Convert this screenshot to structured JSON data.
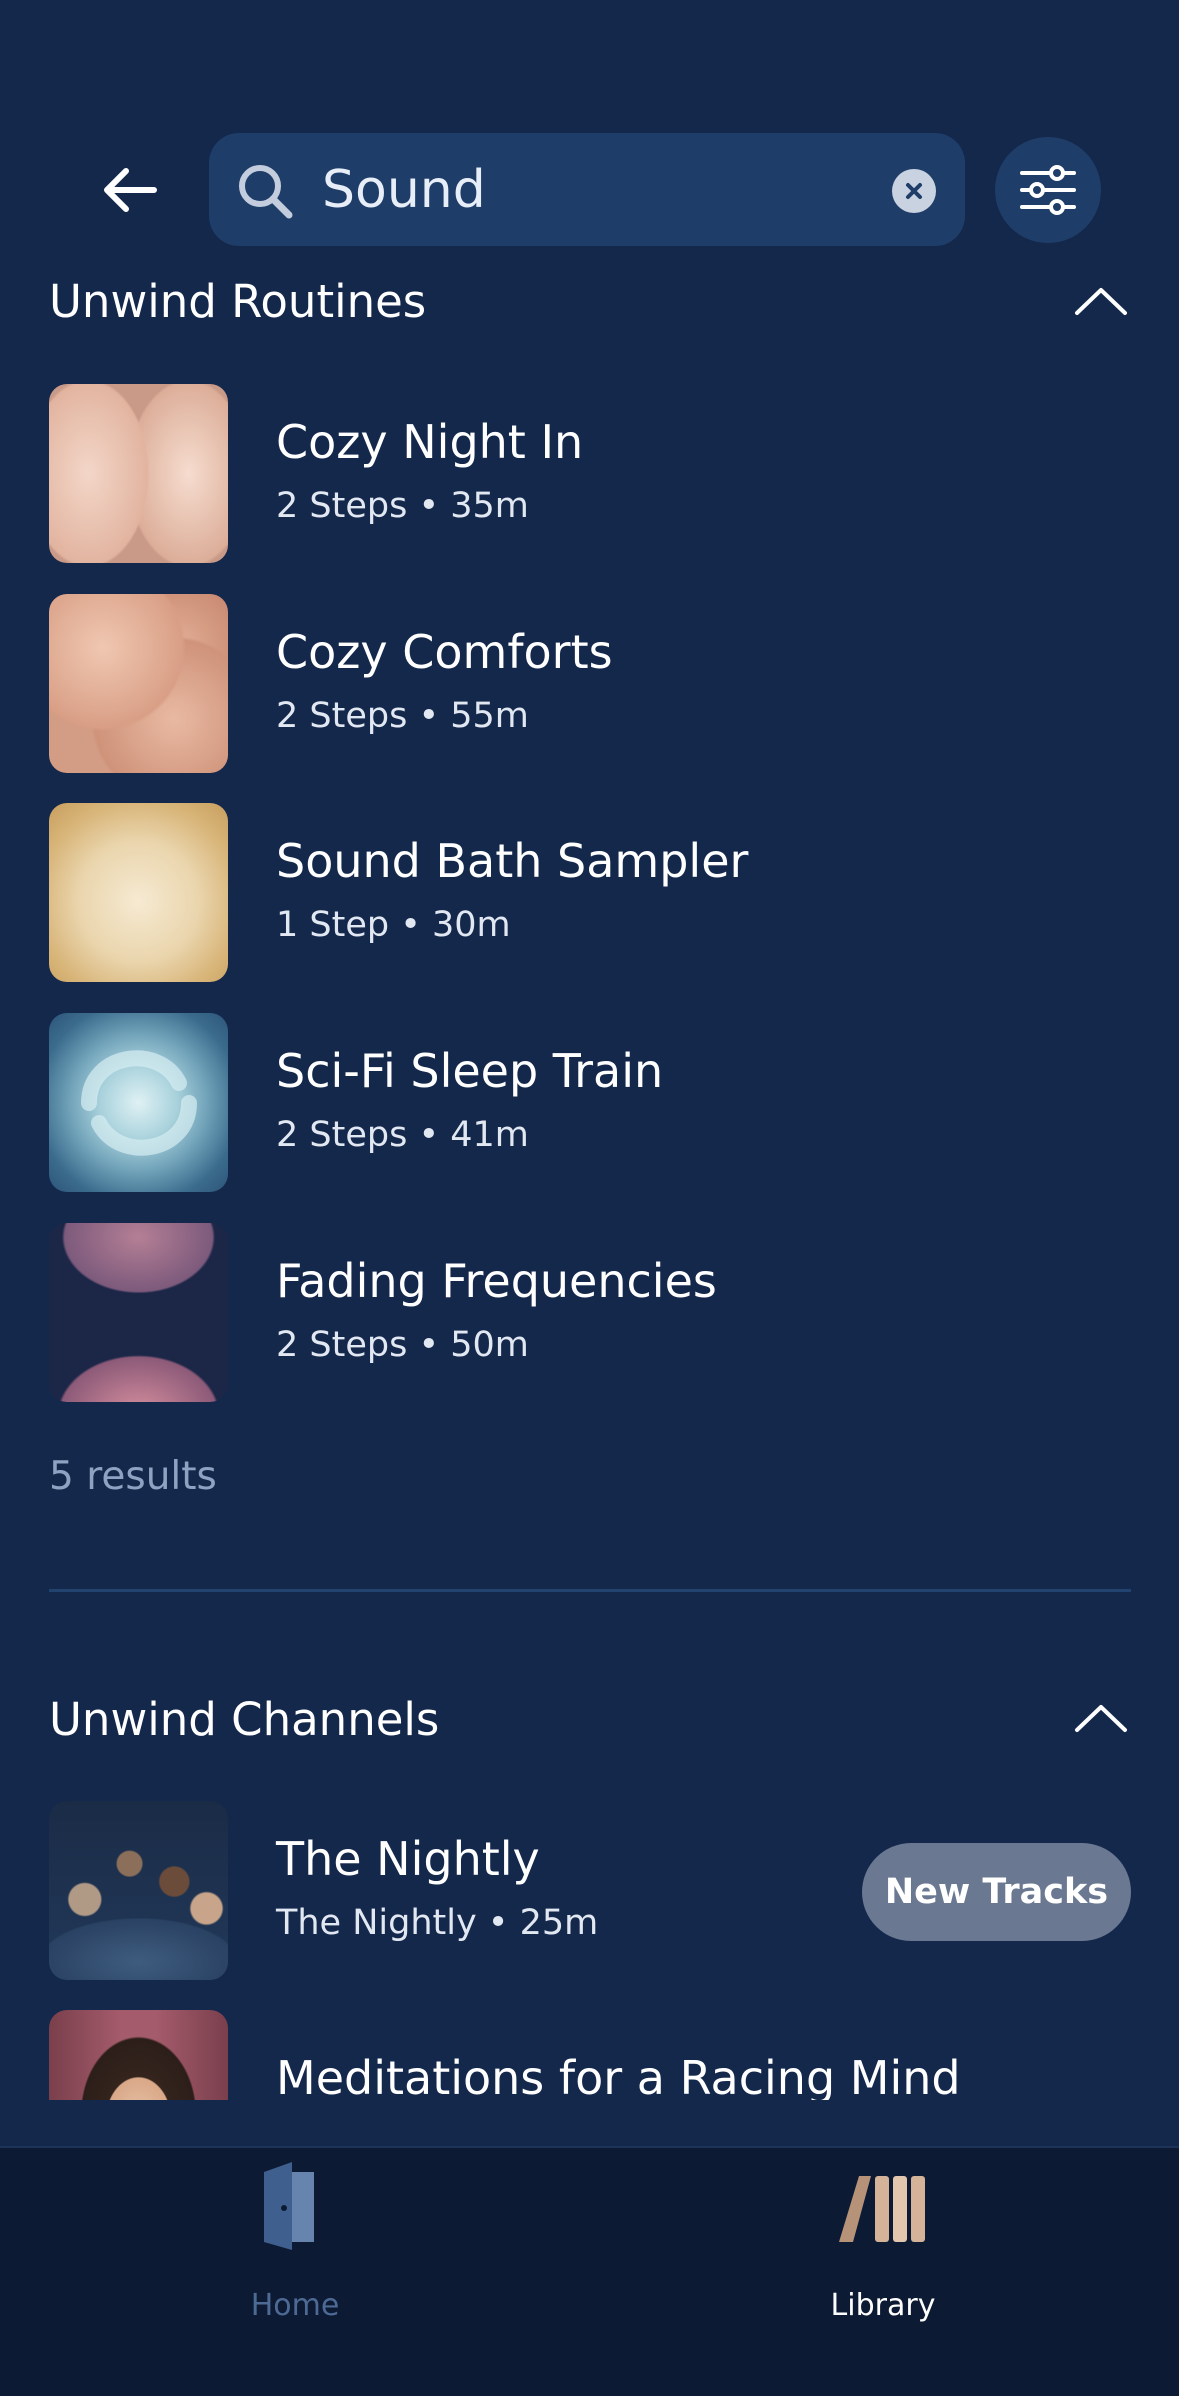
{
  "search": {
    "value": "Sound"
  },
  "routines": {
    "title": "Unwind Routines",
    "items": [
      {
        "title": "Cozy Night In",
        "subtitle": "2 Steps • 35m"
      },
      {
        "title": "Cozy Comforts",
        "subtitle": "2 Steps • 55m"
      },
      {
        "title": "Sound Bath Sampler",
        "subtitle": "1 Step • 30m"
      },
      {
        "title": "Sci-Fi Sleep Train",
        "subtitle": "2 Steps • 41m"
      },
      {
        "title": "Fading Frequencies",
        "subtitle": "2 Steps • 50m"
      }
    ],
    "results_label": "5 results"
  },
  "channels": {
    "title": "Unwind Channels",
    "items": [
      {
        "title": "The Nightly",
        "subtitle": "The Nightly • 25m",
        "badge": "New Tracks"
      },
      {
        "title": "Meditations for a Racing Mind"
      }
    ]
  },
  "nav": {
    "home_label": "Home",
    "library_label": "Library"
  },
  "colors": {
    "background": "#14284c",
    "search_field": "#1e3d68",
    "nav_background": "#0d1a33",
    "active_nav": "#ffffff",
    "inactive_nav": "#4d6a95"
  }
}
